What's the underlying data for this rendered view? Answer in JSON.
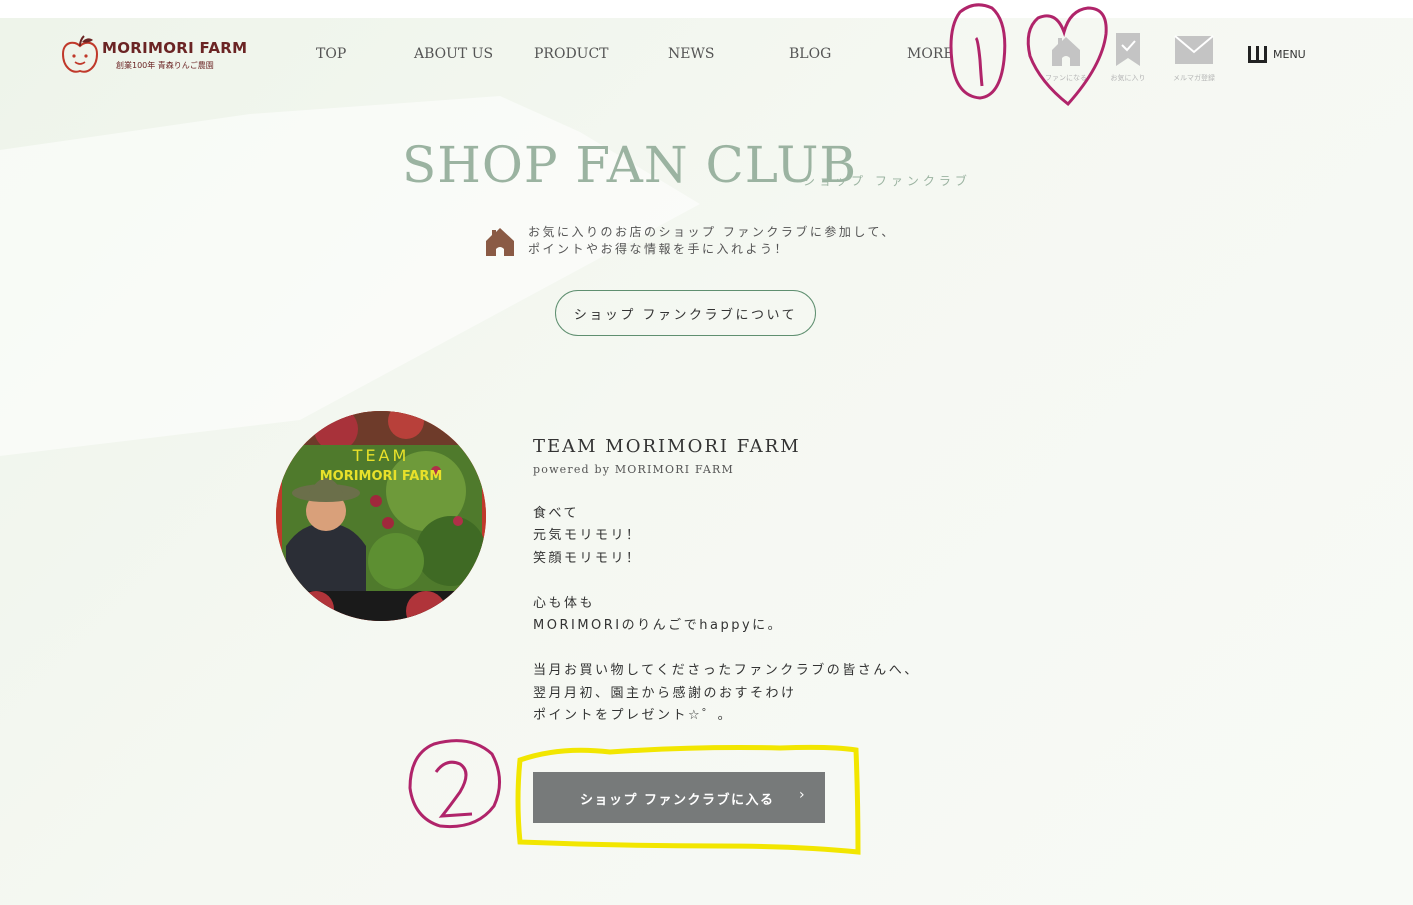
{
  "header": {
    "logo_name": "MORIMORI FARM",
    "logo_sub": "創業100年 青森りんご農園",
    "nav": [
      "TOP",
      "ABOUT US",
      "PRODUCT",
      "NEWS",
      "BLOG",
      "MORE"
    ],
    "icons": {
      "become_fan": "ファンになる",
      "favorites": "お気に入り",
      "newsletter": "メルマガ登録"
    },
    "menu_label": "MENU"
  },
  "main": {
    "title": "SHOP FAN CLUB",
    "title_sub": "ショップ ファンクラブ",
    "intro_line1": "お気に入りのお店のショップ ファンクラブに参加して、",
    "intro_line2": "ポイントやお得な情報を手に入れよう！",
    "about_button": "ショップ ファンクラブについて",
    "team": {
      "photo_caption_line1": "TEAM",
      "photo_caption_line2": "MORIMORI FARM",
      "name": "TEAM MORIMORI FARM",
      "powered": "powered by MORIMORI FARM",
      "description": [
        "食べて",
        "元気モリモリ！",
        "笑顔モリモリ！",
        "",
        "心も体も",
        "MORIMORIのりんごでhappyに。",
        "",
        "当月お買い物してくださったファンクラブの皆さんへ、",
        "翌月月初、園主から感謝のおすそわけ",
        "ポイントをプレゼント☆゜。"
      ]
    },
    "join_button": "ショップ ファンクラブに入る",
    "join_arrow": "›"
  },
  "annotations": {
    "mark1": "1",
    "mark2": "2"
  },
  "colors": {
    "title": "#9bb3a1",
    "logo": "#6b2424",
    "join_button_bg": "#777a7a",
    "about_button_border": "#5f8f70",
    "annotation_pen": "#b0246a",
    "highlight": "#f2e600"
  }
}
